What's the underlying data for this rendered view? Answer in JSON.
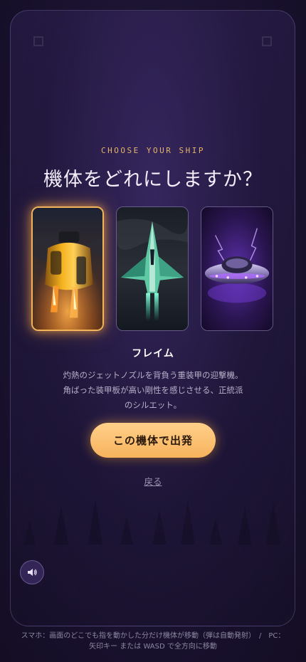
{
  "colors": {
    "accent": "#f2b45a",
    "background": "#1d1536",
    "text_primary": "#f4eefa",
    "text_muted": "#b7b0c8",
    "subtitle": "#e4b46a"
  },
  "header": {
    "subtitle": "CHOOSE YOUR SHIP",
    "title": "機体をどれにしますか？"
  },
  "ships": [
    {
      "id": "flame",
      "selected": true,
      "icon": "yellow-rocket-ship-image"
    },
    {
      "id": "jet",
      "selected": false,
      "icon": "green-jet-fighter-image"
    },
    {
      "id": "ufo",
      "selected": false,
      "icon": "purple-ufo-image"
    }
  ],
  "selected_ship": {
    "name": "フレイム",
    "description_line1": "灼熱のジェットノズルを背負う重装甲の迎撃機。",
    "description_line2": "角ばった装甲板が高い剛性を感じさせる、正統派",
    "description_line3": "のシルエット。"
  },
  "actions": {
    "launch_label": "この機体で出発",
    "back_label": "戻る"
  },
  "sound": {
    "icon": "speaker-icon",
    "state": "on"
  },
  "footer": {
    "line1": "スマホ：画面のどこでも指を動かした分だけ機体が移動（弾は自動発射）　/　PC：",
    "line2": "矢印キー または WASD で全方向に移動"
  }
}
